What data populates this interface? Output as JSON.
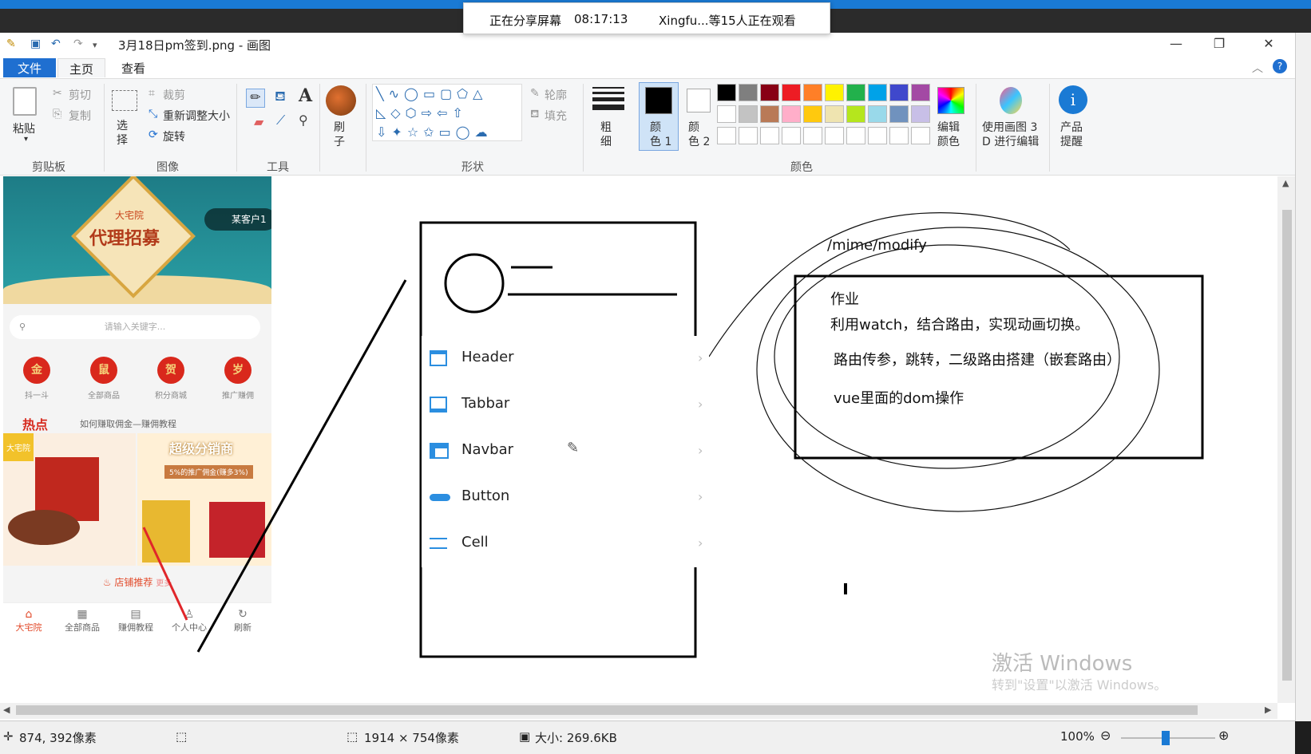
{
  "window": {
    "title": "3月18日pm签到.png - 画图"
  },
  "share_banner": {
    "status": "正在分享屏幕",
    "time": "08:17:13",
    "viewers": "Xingfu...等15人正在观看"
  },
  "tabs": [
    "文件",
    "主页",
    "查看"
  ],
  "ribbon": {
    "clipboard": {
      "paste": "粘贴",
      "cut": "剪切",
      "copy": "复制",
      "group": "剪贴板"
    },
    "image": {
      "select": "选\n择",
      "crop": "裁剪",
      "resize": "重新调整大小",
      "rotate": "旋转",
      "group": "图像"
    },
    "tools": {
      "group": "工具"
    },
    "brush": {
      "label": "刷\n子"
    },
    "shapes": {
      "outline": "轮廓",
      "fill": "填充",
      "group": "形状"
    },
    "size": {
      "label": "粗\n细"
    },
    "color1": "颜\n色 1",
    "color2": "颜\n色 2",
    "colors_group": "颜色",
    "edit_colors": "编辑\n颜色",
    "paint3d": "使用画图 3\nD 进行编辑",
    "product_alert": "产品\n提醒",
    "palette": [
      "#000000",
      "#7f7f7f",
      "#880015",
      "#ed1c24",
      "#ff7f27",
      "#fff200",
      "#22b14c",
      "#00a2e8",
      "#3f48cc",
      "#a349a4",
      "#ffffff",
      "#c3c3c3",
      "#b97a57",
      "#ffaec9",
      "#ffc90e",
      "#efe4b0",
      "#b5e61d",
      "#99d9ea",
      "#7092be",
      "#c8bfe7"
    ]
  },
  "phone": {
    "banner_title": "代理招募",
    "banner_brand": "大宅院",
    "banner_badge": "某客户1",
    "search_placeholder": "请输入关键字...",
    "icons": [
      {
        "glyph": "金",
        "label": "抖一斗"
      },
      {
        "glyph": "鼠",
        "label": "全部商品"
      },
      {
        "glyph": "贺",
        "label": "积分商城"
      },
      {
        "glyph": "岁",
        "label": "推广赚佣"
      }
    ],
    "hot_label": "热点",
    "hot_link": "如何赚取佣金—赚佣教程",
    "promo_title": "超级分销商",
    "promo_sub": "5%的推广佣金(赚多3%)",
    "tag": "大宅院",
    "store_recommend": "店铺推荐",
    "more": "更多",
    "nav": [
      "大宅院",
      "全部商品",
      "赚佣教程",
      "个人中心",
      "刷新"
    ]
  },
  "list": {
    "items": [
      "Header",
      "Tabbar",
      "Navbar",
      "Button",
      "Cell"
    ]
  },
  "notes": {
    "route": "/mime/modify",
    "title": "作业",
    "line1": "利用watch，结合路由，实现动画切换。",
    "line2": "路由传参，跳转，二级路由搭建（嵌套路由）",
    "line3": "vue里面的dom操作"
  },
  "watermark": {
    "line1": "激活 Windows",
    "line2": "转到\"设置\"以激活 Windows。"
  },
  "status": {
    "cursor": "874, 392像素",
    "dimensions": "1914 × 754像素",
    "size": "大小: 269.6KB",
    "zoom": "100%"
  }
}
